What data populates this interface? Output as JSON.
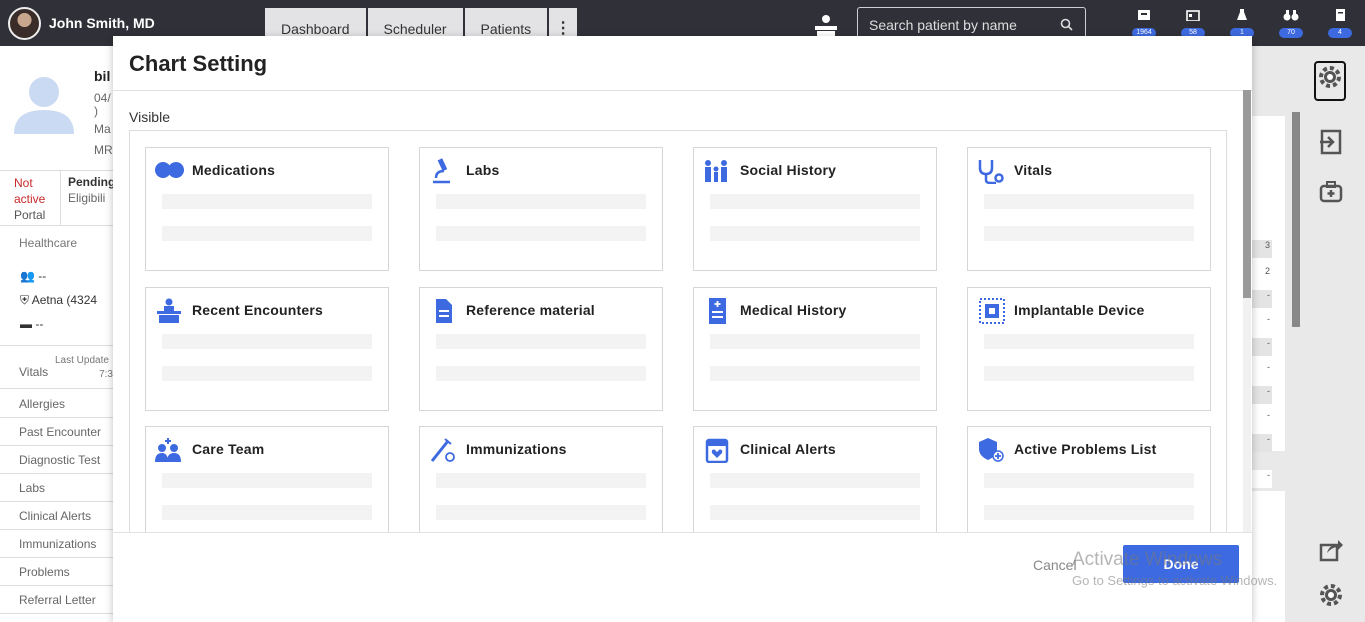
{
  "topbar": {
    "user_name": "John Smith, MD",
    "nav_tabs": [
      "Dashboard",
      "Scheduler",
      "Patients"
    ],
    "more_label": "⋮",
    "search_placeholder": "Search patient by name",
    "stats": [
      {
        "icon": "inbox-icon",
        "count": "1964"
      },
      {
        "icon": "calendar-icon",
        "count": "58"
      },
      {
        "icon": "lab-icon",
        "count": "1"
      },
      {
        "icon": "binoculars-icon",
        "count": "70"
      },
      {
        "icon": "notebook-icon",
        "count": "4"
      }
    ]
  },
  "patient": {
    "name": "bil",
    "line1": "04/",
    "line2": ")",
    "line3": "Ma",
    "line4": "MR",
    "status_not_active": "Not active",
    "status_portal": "Portal",
    "pending": "Pending",
    "eligibility": "Eligibili",
    "healthcare_label": "Healthcare",
    "healthcare_rows": [
      "--",
      "Aetna (4324",
      "--"
    ],
    "vitals_label": "Vitals",
    "vitals_updated": "Last Update",
    "vitals_time": "7:3",
    "menu": [
      "Allergies",
      "Past Encounter",
      "Diagnostic Test",
      "Labs",
      "Clinical Alerts",
      "Immunizations",
      "Problems",
      "Referral Letter"
    ]
  },
  "right_panel": {
    "cells": [
      "3",
      "2",
      "-",
      "-",
      "-",
      "-",
      "-",
      "-",
      "-",
      "-"
    ]
  },
  "modal": {
    "title": "Chart Setting",
    "visible_label": "Visible",
    "cancel_label": "Cancel",
    "done_label": "Done",
    "cards": [
      {
        "title": "Medications",
        "icon": "pills-icon"
      },
      {
        "title": "Labs",
        "icon": "microscope-icon"
      },
      {
        "title": "Social History",
        "icon": "family-icon"
      },
      {
        "title": "Vitals",
        "icon": "stethoscope-icon"
      },
      {
        "title": "Recent Encounters",
        "icon": "reception-icon"
      },
      {
        "title": "Reference material",
        "icon": "document-icon"
      },
      {
        "title": "Medical History",
        "icon": "medical-record-icon"
      },
      {
        "title": "Implantable Device",
        "icon": "chip-icon"
      },
      {
        "title": "Care Team",
        "icon": "team-icon"
      },
      {
        "title": "Immunizations",
        "icon": "syringe-icon"
      },
      {
        "title": "Clinical Alerts",
        "icon": "calendar-heart-icon"
      },
      {
        "title": "Active Problems List",
        "icon": "shield-plus-icon"
      }
    ]
  },
  "watermark": {
    "line1": "Activate Windows",
    "line2": "Go to Settings to activate Windows."
  },
  "colors": {
    "accent": "#3d6ae0",
    "topbar": "#303038",
    "alert": "#c62828"
  }
}
